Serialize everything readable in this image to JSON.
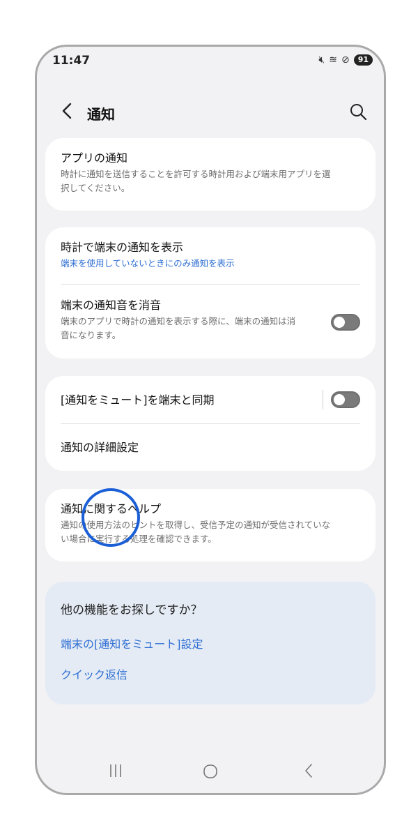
{
  "status": {
    "time": "11:47",
    "battery": "91"
  },
  "header": {
    "title": "通知"
  },
  "cards": {
    "app_notifications": {
      "title": "アプリの通知",
      "subtitle": "時計に通知を送信することを許可する時計用および端末用アプリを選択してください。",
      "subtitle_lines": [
        "時計に通知を送信することを許可する時計用および端末用アプリを選",
        "択してください。"
      ]
    },
    "show_phone": {
      "title": "時計で端末の通知を表示",
      "subtitle": "端末を使用していないときにのみ通知を表示"
    },
    "mute_sound": {
      "title": "端末の通知音を消音",
      "subtitle_lines": [
        "端末のアプリで時計の通知を表示する際に、端末の通知は消",
        "音になります。"
      ],
      "toggle_on": false
    },
    "sync_mute": {
      "title": "[通知をミュート]を端末と同期",
      "toggle_on": false
    },
    "advanced": {
      "title": "通知の詳細設定"
    },
    "help": {
      "title": "通知に関するヘルプ",
      "subtitle_lines": [
        "通知の使用方法のヒントを取得し、受信予定の通知が受信されていな",
        "い場合に実行する処理を確認できます。"
      ]
    }
  },
  "looking_for": {
    "title": "他の機能をお探しですか？",
    "links": [
      "端末の[通知をミュート]設定",
      "クイック返信"
    ]
  },
  "colors": {
    "accent": "#2f6fd3",
    "touch_indicator": "#1a5fd6"
  }
}
